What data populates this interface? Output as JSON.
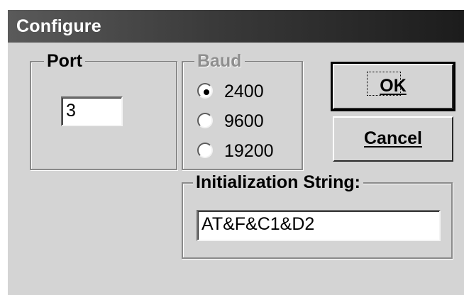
{
  "window": {
    "title": "Configure"
  },
  "port": {
    "legend": "Port",
    "value": "3"
  },
  "baud": {
    "legend": "Baud",
    "options": [
      {
        "label": "2400",
        "selected": true
      },
      {
        "label": "9600",
        "selected": false
      },
      {
        "label": "19200",
        "selected": false
      }
    ]
  },
  "init": {
    "legend": "Initialization String:",
    "value": "AT&F&C1&D2"
  },
  "buttons": {
    "ok": "OK",
    "cancel": "Cancel"
  },
  "colors": {
    "title_dark": "#1c1c1c",
    "title_light": "#5a5a5a",
    "face": "#d4d4d4"
  }
}
